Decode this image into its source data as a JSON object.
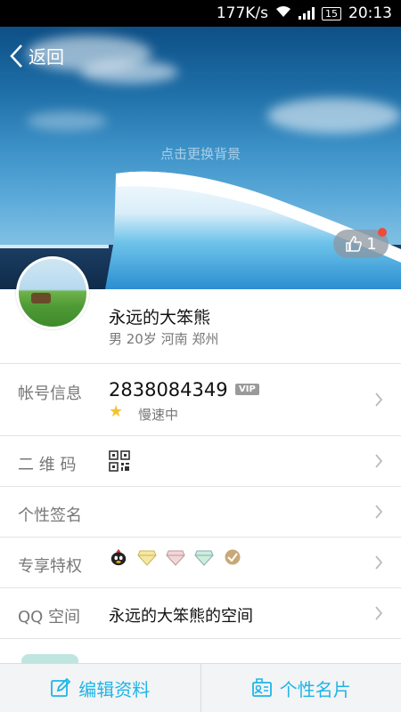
{
  "status_bar": {
    "speed": "177K/s",
    "battery": "15",
    "time": "20:13"
  },
  "header": {
    "back_label": "返回",
    "change_bg": "点击更换背景",
    "like_count": "1"
  },
  "profile": {
    "nickname": "永远的大笨熊",
    "subinfo": "男 20岁 河南 郑州"
  },
  "rows": {
    "account": {
      "label": "帐号信息",
      "number": "2838084349",
      "vip": "VIP",
      "speed": "慢速中"
    },
    "qrcode": {
      "label": "二 维 码"
    },
    "signature": {
      "label": "个性签名"
    },
    "privilege": {
      "label": "专享特权"
    },
    "qzone": {
      "label": "QQ 空间",
      "value": "永远的大笨熊的空间"
    }
  },
  "bottom_bar": {
    "edit_label": "编辑资料",
    "card_label": "个性名片"
  },
  "colors": {
    "accent": "#1eb5e8",
    "badge_dot": "#f04b3a",
    "label_gray": "#777777"
  },
  "icons": [
    "back-icon",
    "thumbs-up-icon",
    "star-icon",
    "qr-code-icon",
    "penguin-badge-icon",
    "diamond-badge-icon",
    "chevron-right-icon",
    "edit-icon",
    "card-icon"
  ]
}
